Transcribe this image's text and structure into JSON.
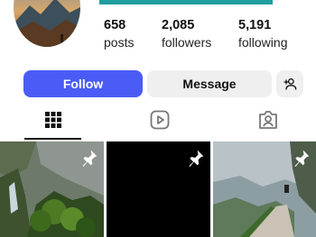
{
  "profile": {
    "stats": [
      {
        "count": "658",
        "label": "posts"
      },
      {
        "count": "2,085",
        "label": "followers"
      },
      {
        "count": "5,191",
        "label": "following"
      }
    ]
  },
  "actions": {
    "follow_label": "Follow",
    "message_label": "Message"
  },
  "tabs": {
    "active": "posts-grid",
    "icons": [
      "grid-icon",
      "reels-icon",
      "tagged-icon"
    ]
  },
  "grid": {
    "tiles": [
      {
        "image": "mountain-river-forest",
        "pinned": true
      },
      {
        "image": "black",
        "pinned": true
      },
      {
        "image": "mountain-road-valley",
        "pinned": true
      }
    ]
  },
  "colors": {
    "accent": "#4a5cf5",
    "secondary_button": "#efefef",
    "banner": "#1f9e9f"
  }
}
